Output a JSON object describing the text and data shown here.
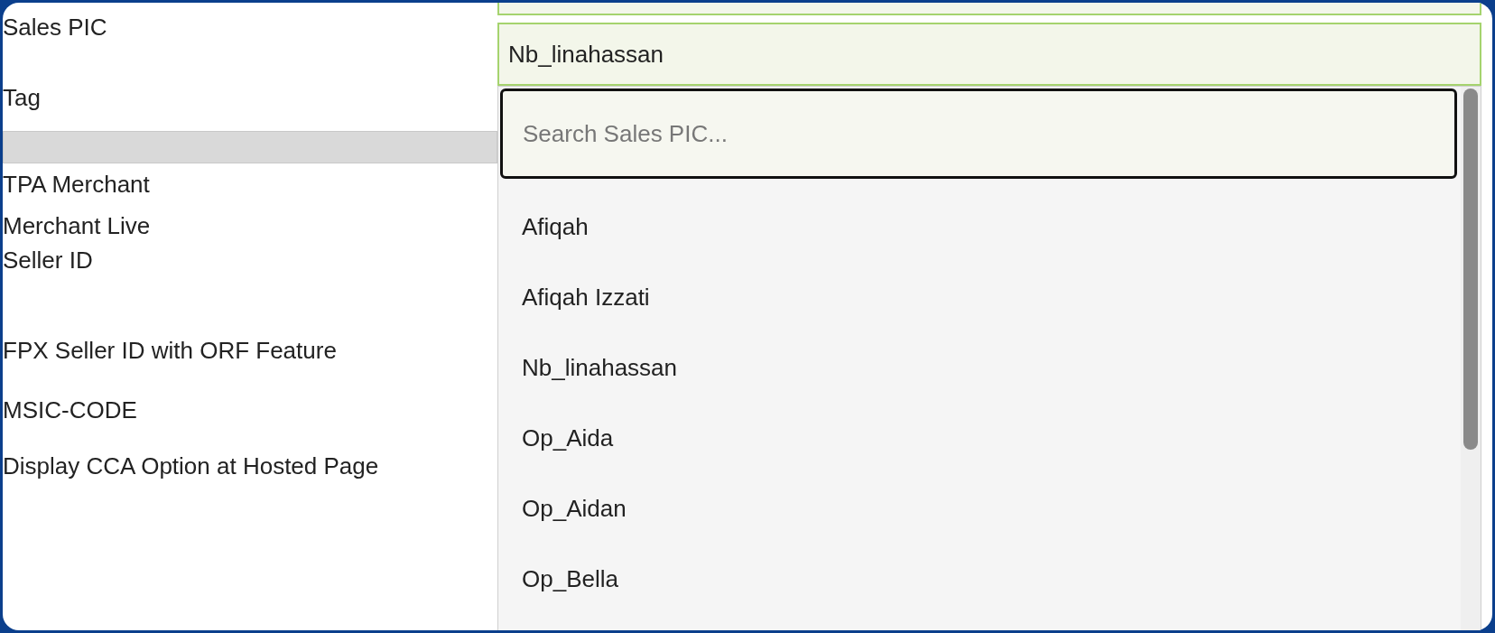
{
  "form_labels": [
    "Sales PIC",
    "Tag",
    "TPA Merchant",
    "Merchant Live",
    "Seller ID",
    "FPX Seller ID with ORF Feature",
    "MSIC-CODE",
    "Display CCA Option at Hosted Page"
  ],
  "sales_pic": {
    "value": "Nb_linahassan"
  },
  "dropdown": {
    "search": {
      "placeholder": "Search Sales PIC..."
    },
    "options": [
      "Afiqah",
      "Afiqah Izzati",
      "Nb_linahassan",
      "Op_Aida",
      "Op_Aidan",
      "Op_Bella"
    ]
  }
}
